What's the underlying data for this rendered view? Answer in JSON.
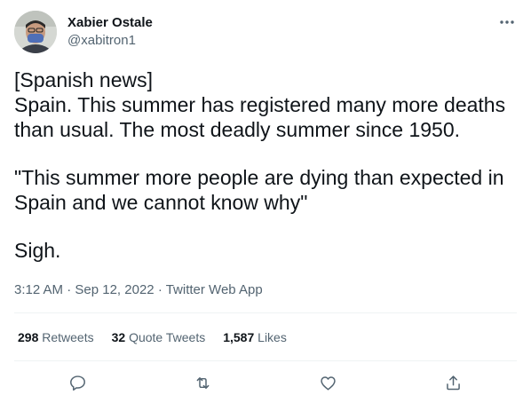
{
  "author": {
    "display_name": "Xabier Ostale",
    "handle": "@xabitron1",
    "avatar_icon": "profile-avatar"
  },
  "tweet": {
    "line1": "[Spanish news]",
    "line2": "Spain. This summer has registered many more deaths than usual. The most deadly summer since 1950.",
    "quote": "\"This summer more people are dying than expected in Spain and we cannot know why\"",
    "closing": "Sigh."
  },
  "meta": {
    "time": "3:12 AM",
    "date": "Sep 12, 2022",
    "separator": "·",
    "source": "Twitter Web App"
  },
  "stats": {
    "retweets_count": "298",
    "retweets_label": "Retweets",
    "quotes_count": "32",
    "quotes_label": "Quote Tweets",
    "likes_count": "1,587",
    "likes_label": "Likes"
  },
  "actions": {
    "reply_icon": "reply-icon",
    "retweet_icon": "retweet-icon",
    "like_icon": "like-icon",
    "share_icon": "share-icon"
  },
  "colors": {
    "text_primary": "#0f1419",
    "text_secondary": "#536471",
    "divider": "#eff3f4"
  }
}
